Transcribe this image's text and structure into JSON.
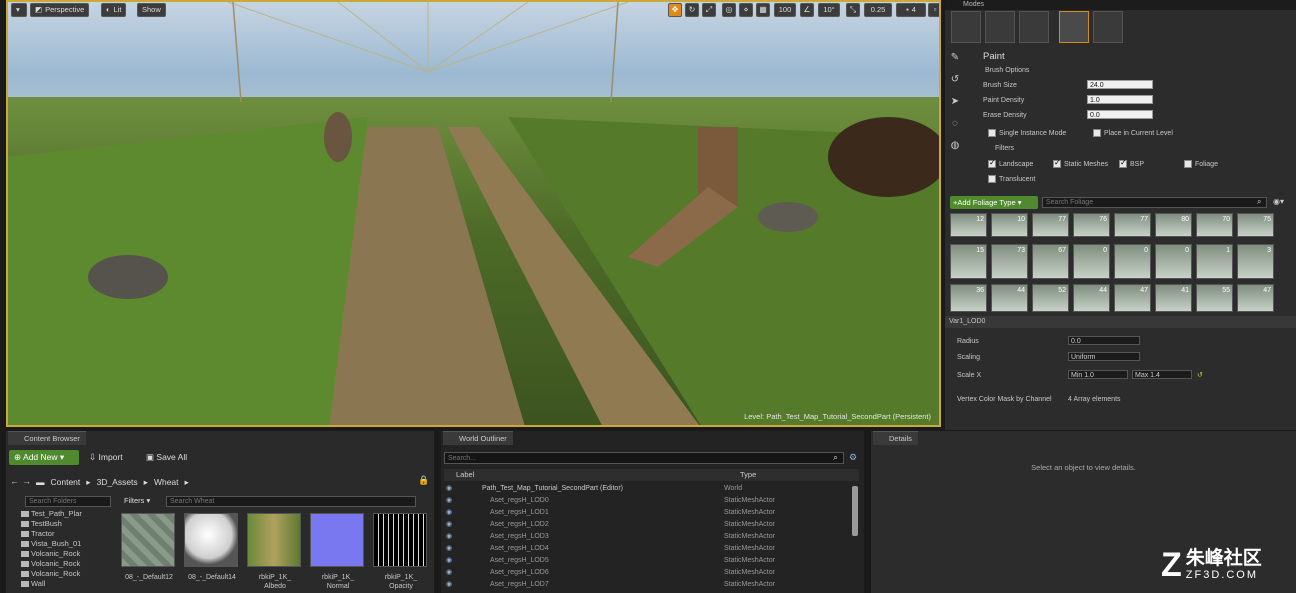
{
  "viewport": {
    "perspective": "Perspective",
    "lit": "Lit",
    "show": "Show",
    "grid_snap": "100",
    "rot_snap": "10°",
    "scale_snap": "0.25",
    "camera_speed": "4",
    "level_label": "Level:  Path_Test_Map_Tutorial_SecondPart (Persistent)"
  },
  "modes": {
    "tab": "Modes",
    "paint_title": "Paint",
    "brush_options": "Brush Options",
    "brush_size_label": "Brush Size",
    "brush_size": "24.0",
    "paint_density_label": "Paint Density",
    "paint_density": "1.0",
    "erase_density_label": "Erase Density",
    "erase_density": "0.0",
    "single_instance": "Single Instance Mode",
    "place_current_level": "Place in Current Level",
    "filters": "Filters",
    "landscape": "Landscape",
    "static_meshes": "Static Meshes",
    "bsp": "BSP",
    "foliage": "Foliage",
    "translucent": "Translucent",
    "add_foliage_type": "+Add Foliage Type",
    "search_foliage": "Search Foliage",
    "thumb_counts": [
      "12",
      "10",
      "77",
      "76",
      "77",
      "80",
      "70",
      "75",
      "",
      "",
      "",
      "",
      "",
      "",
      "",
      "",
      "",
      "",
      ""
    ],
    "grid_counts_row2": [
      "15",
      "73",
      "67",
      "0",
      "0",
      "0",
      "1",
      "3"
    ],
    "grid_counts_row3": [
      "36",
      "44",
      "52",
      "44",
      "47",
      "41",
      "55",
      "47"
    ],
    "selected_type": "Var1_LOD0",
    "radius_label": "Radius",
    "radius": "0.0",
    "scaling_label": "Scaling",
    "scaling": "Uniform",
    "scale_x_label": "Scale X",
    "scale_min": "Min  1.0",
    "scale_max": "Max  1.4",
    "vertex_mask_label": "Vertex Color Mask by Channel",
    "vertex_mask_value": "4 Array elements"
  },
  "content_browser": {
    "tab": "Content Browser",
    "add_new": "Add New",
    "import": "Import",
    "save_all": "Save All",
    "breadcrumb": [
      "Content",
      "3D_Assets",
      "Wheat"
    ],
    "search_folders": "Search Folders",
    "filters": "Filters",
    "search_assets": "Search Wheat",
    "folders": [
      "Test_Path_Plar",
      "TestBush",
      "Tractor",
      "Vista_Bush_01",
      "Volcanic_Rock",
      "Volcanic_Rock",
      "Volcanic_Rock",
      "Wall"
    ],
    "assets": [
      {
        "name": "08_-_Default12",
        "sub": ""
      },
      {
        "name": "08_-_Default14",
        "sub": ""
      },
      {
        "name": "rbkiP_1K_",
        "sub": "Albedo"
      },
      {
        "name": "rbkiP_1K_",
        "sub": "Normal"
      },
      {
        "name": "rbkiP_1K_",
        "sub": "Opacity"
      }
    ]
  },
  "world_outliner": {
    "tab": "World Outliner",
    "search": "Search...",
    "col_label": "Label",
    "col_type": "Type",
    "rows": [
      {
        "label": "Path_Test_Map_Tutorial_SecondPart (Editor)",
        "type": "World"
      },
      {
        "label": "Aset_regsH_LOD0",
        "type": "StaticMeshActor"
      },
      {
        "label": "Aset_regsH_LOD1",
        "type": "StaticMeshActor"
      },
      {
        "label": "Aset_regsH_LOD2",
        "type": "StaticMeshActor"
      },
      {
        "label": "Aset_regsH_LOD3",
        "type": "StaticMeshActor"
      },
      {
        "label": "Aset_regsH_LOD4",
        "type": "StaticMeshActor"
      },
      {
        "label": "Aset_regsH_LOD5",
        "type": "StaticMeshActor"
      },
      {
        "label": "Aset_regsH_LOD6",
        "type": "StaticMeshActor"
      },
      {
        "label": "Aset_regsH_LOD7",
        "type": "StaticMeshActor"
      }
    ]
  },
  "details": {
    "tab": "Details",
    "empty": "Select an object to view details."
  },
  "watermark": {
    "brand": "朱峰社区",
    "domain": "ZF3D.COM"
  }
}
